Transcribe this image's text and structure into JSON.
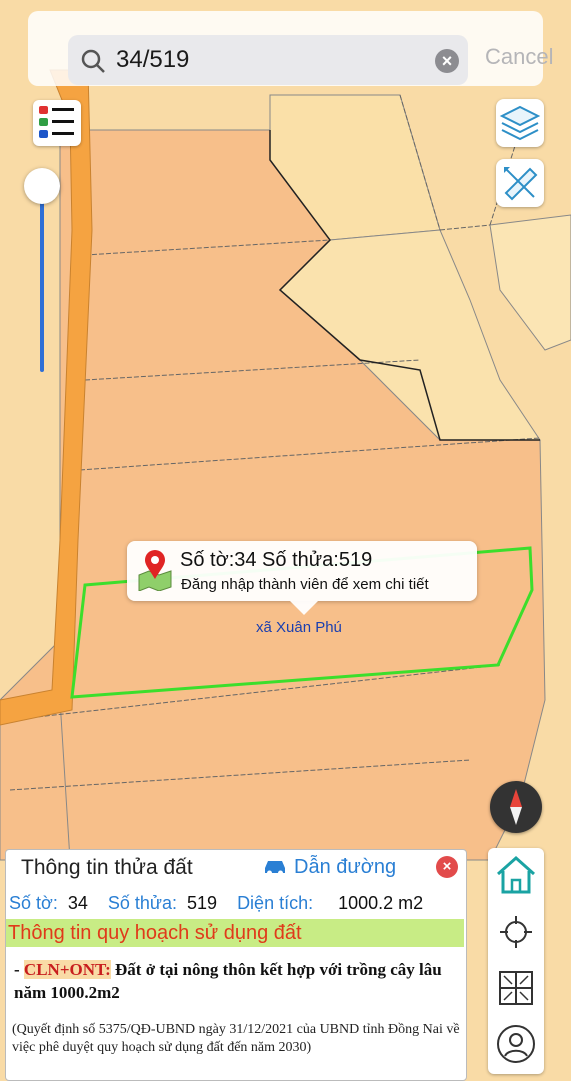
{
  "search": {
    "query": "34/519",
    "cancel_label": "Cancel"
  },
  "map": {
    "parcel_popup": {
      "title": "Số tờ:34 Số thửa:519",
      "subtitle": "Đăng nhập thành viên để xem chi tiết"
    },
    "commune_label": "xã Xuân Phú",
    "colors": {
      "land_light": "#f9dba6",
      "land_orange": "#f7bf8a",
      "road": "#f5a341",
      "highlight": "#3cde2c",
      "boundary": "#222222"
    }
  },
  "info_panel": {
    "title": "Thông tin thửa đất",
    "directions_label": "Dẫn đường",
    "sheet_label": "Số tờ:",
    "sheet_value": "34",
    "parcel_label": "Số thửa:",
    "parcel_value": "519",
    "area_label": "Diện tích:",
    "area_value": "1000.2 m2",
    "planning_header": "Thông tin quy hoạch sử dụng đất",
    "plan_prefix": "- ",
    "plan_code": "CLN+ONT:",
    "plan_description": " Đất ở tại nông thôn kết hợp với trồng cây lâu năm 1000.2m2",
    "decision_note": "(Quyết định số 5375/QĐ-UBND ngày 31/12/2021 của UBND tỉnh Đồng Nai về việc phê duyệt quy hoạch sử dụng đất đến năm 2030)"
  },
  "icons": {
    "search": "search-icon",
    "clear": "clear-icon",
    "legend": "legend-icon",
    "layers": "layers-icon",
    "measure": "ruler-icon",
    "compass": "compass-icon",
    "home": "home-icon",
    "locate": "crosshair-icon",
    "parcels": "parcel-grid-icon",
    "profile": "profile-icon",
    "car": "car-icon",
    "pin": "map-pin-icon"
  }
}
